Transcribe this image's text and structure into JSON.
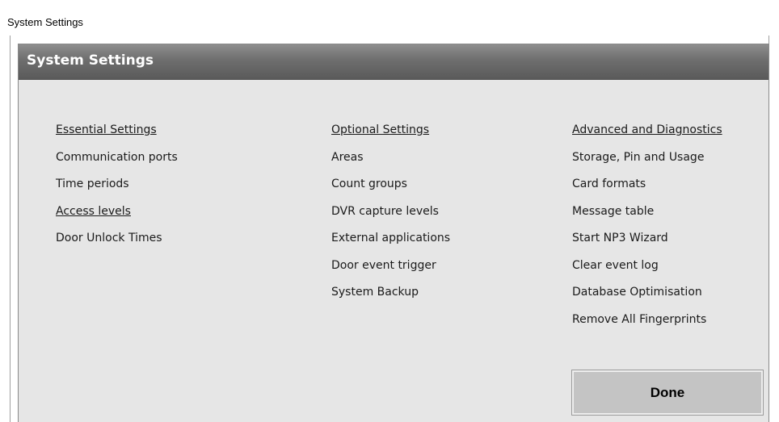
{
  "window": {
    "title": "System Settings"
  },
  "panel": {
    "header": "System Settings"
  },
  "columns": [
    {
      "heading": "Essential Settings",
      "items": [
        "Communication ports",
        "Time periods",
        "Access levels",
        "Door Unlock Times"
      ]
    },
    {
      "heading": "Optional Settings",
      "items": [
        "Areas",
        "Count groups",
        "DVR capture levels",
        "External applications",
        "Door event trigger",
        "System Backup"
      ]
    },
    {
      "heading": "Advanced and Diagnostics",
      "items": [
        "Storage, Pin and Usage",
        "Card formats",
        "Message table",
        "Start NP3 Wizard",
        "Clear event log",
        "Database Optimisation",
        "Remove All Fingerprints"
      ]
    }
  ],
  "buttons": {
    "done": "Done"
  }
}
